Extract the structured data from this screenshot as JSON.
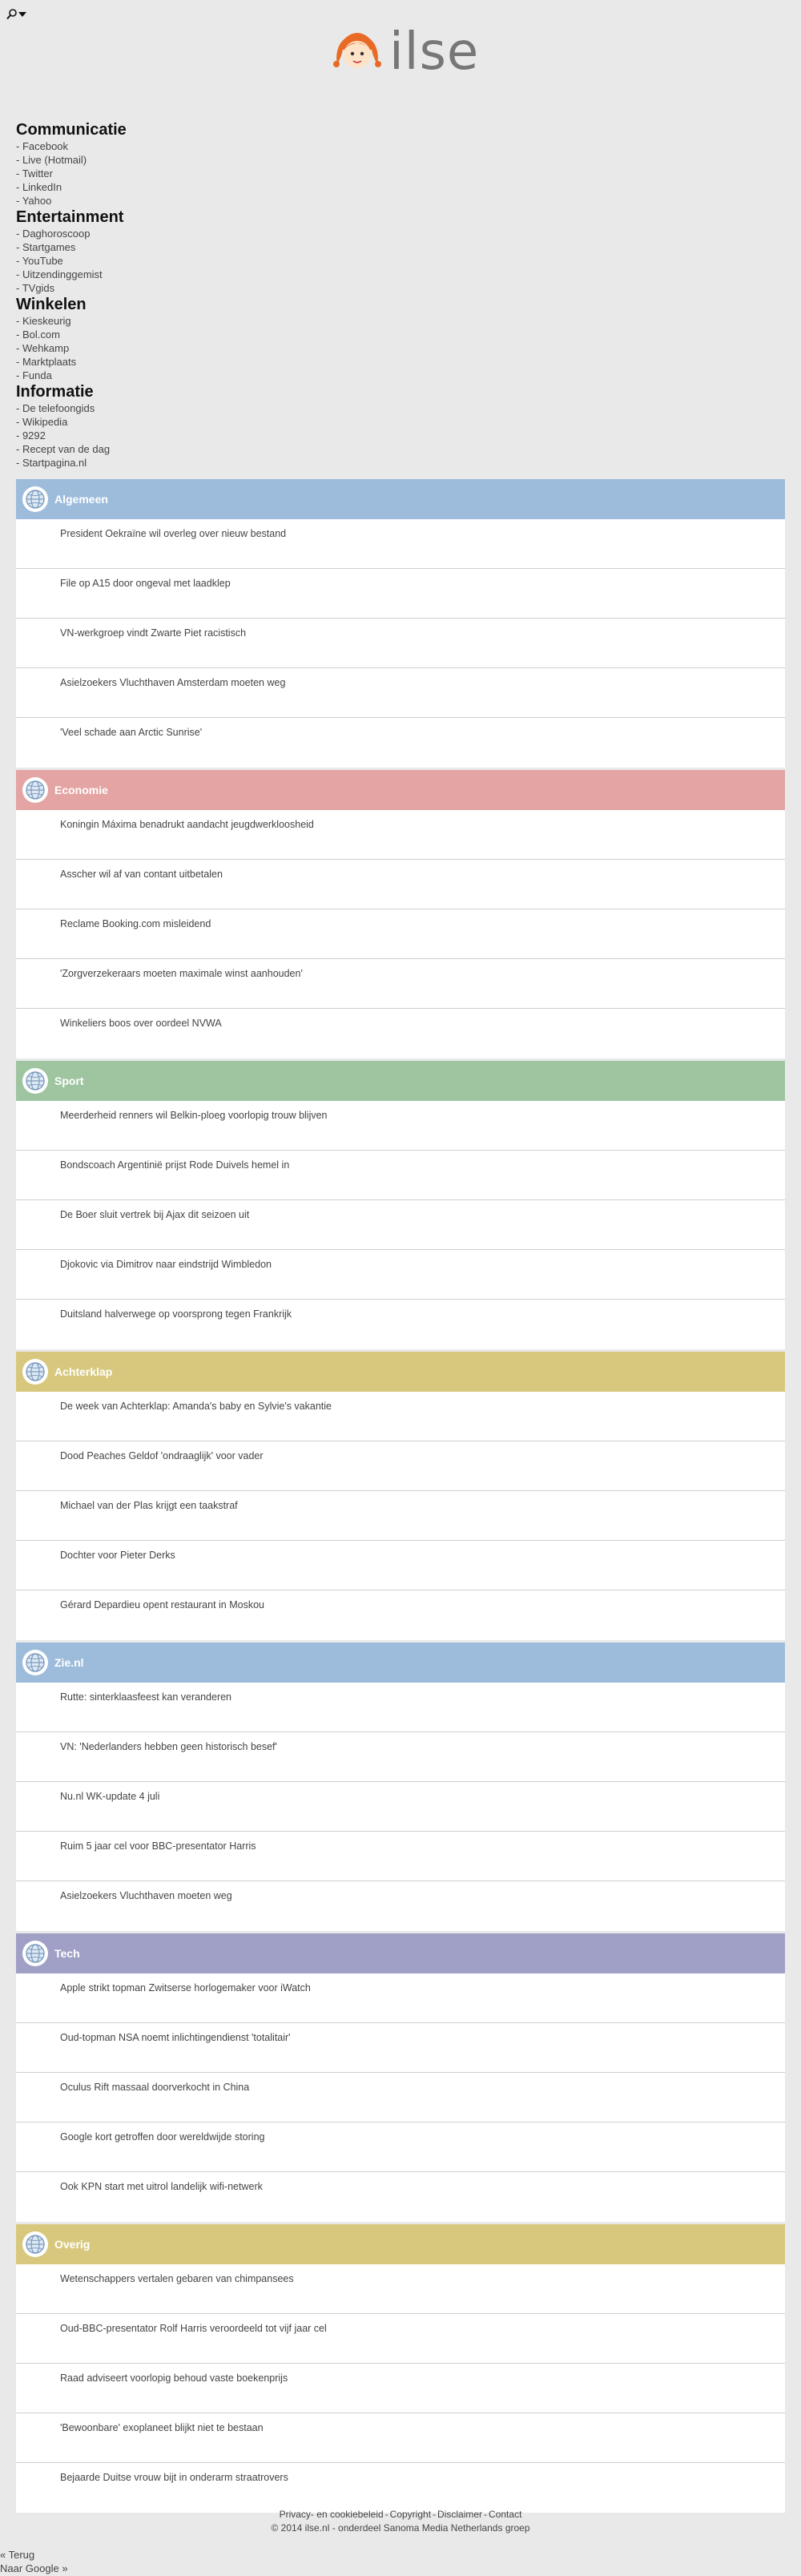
{
  "topbar": {
    "search_icon": "search-icon",
    "dropdown_icon": "caret-down-icon"
  },
  "logo": {
    "text": "ilse"
  },
  "link_groups": [
    {
      "title": "Communicatie",
      "links": [
        "- Facebook",
        "- Live (Hotmail)",
        "- Twitter",
        "- LinkedIn",
        "- Yahoo"
      ]
    },
    {
      "title": "Entertainment",
      "links": [
        "- Daghoroscoop",
        "- Startgames",
        "- YouTube",
        "- Uitzendinggemist",
        "- TVgids"
      ]
    },
    {
      "title": "Winkelen",
      "links": [
        "- Kieskeurig",
        "- Bol.com",
        "- Wehkamp",
        "- Marktplaats",
        "- Funda"
      ]
    },
    {
      "title": "Informatie",
      "links": [
        "- De telefoongids",
        "- Wikipedia",
        "- 9292",
        "- Recept van de dag",
        "- Startpagina.nl"
      ]
    }
  ],
  "sections": [
    {
      "title": "Algemeen",
      "color": "#9dbcdc",
      "items": [
        "President Oekraïne wil overleg over nieuw bestand",
        "File op A15 door ongeval met laadklep",
        "VN-werkgroep vindt Zwarte Piet racistisch",
        "Asielzoekers Vluchthaven Amsterdam moeten weg",
        "'Veel schade aan Arctic Sunrise'"
      ]
    },
    {
      "title": "Economie",
      "color": "#e4a4a3",
      "items": [
        "Koningin Máxima benadrukt aandacht jeugdwerkloosheid",
        "Asscher wil af van contant uitbetalen",
        "Reclame Booking.com misleidend",
        "'Zorgverzekeraars moeten maximale winst aanhouden'",
        "Winkeliers boos over oordeel NVWA"
      ]
    },
    {
      "title": "Sport",
      "color": "#9fc5a0",
      "items": [
        "Meerderheid renners wil Belkin-ploeg voorlopig trouw blijven",
        "Bondscoach Argentinië prijst Rode Duivels hemel in",
        "De Boer sluit vertrek bij Ajax dit seizoen uit",
        "Djokovic via Dimitrov naar eindstrijd Wimbledon",
        "Duitsland halverwege op voorsprong tegen Frankrijk"
      ]
    },
    {
      "title": "Achterklap",
      "color": "#d8c87d",
      "items": [
        "De week van Achterklap: Amanda's baby en Sylvie's vakantie",
        "Dood Peaches Geldof 'ondraaglijk' voor vader",
        "Michael van der Plas krijgt een taakstraf",
        "Dochter voor Pieter Derks",
        "Gérard Depardieu opent restaurant in Moskou"
      ]
    },
    {
      "title": "Zie.nl",
      "color": "#9dbcdc",
      "items": [
        "Rutte: sinterklaasfeest kan veranderen",
        "VN: 'Nederlanders hebben geen historisch besef'",
        "Nu.nl WK-update 4 juli",
        "Ruim 5 jaar cel voor BBC-presentator Harris",
        "Asielzoekers Vluchthaven moeten weg"
      ]
    },
    {
      "title": "Tech",
      "color": "#a09fc6",
      "items": [
        "Apple strikt topman Zwitserse horlogemaker voor iWatch",
        "Oud-topman NSA noemt inlichtingendienst 'totalitair'",
        "Oculus Rift massaal doorverkocht in China",
        "Google kort getroffen door wereldwijde storing",
        "Ook KPN start met uitrol landelijk wifi-netwerk"
      ]
    },
    {
      "title": "Overig",
      "color": "#d8c87d",
      "items": [
        "Wetenschappers vertalen gebaren van chimpansees",
        "Oud-BBC-presentator Rolf Harris veroordeeld tot vijf jaar cel",
        "Raad adviseert voorlopig behoud vaste boekenprijs",
        "'Bewoonbare' exoplaneet blijkt niet te bestaan",
        "Bejaarde Duitse vrouw bijt in onderarm straatrovers"
      ]
    }
  ],
  "footer": {
    "links": [
      "Privacy- en cookiebeleid",
      "Copyright",
      "Disclaimer",
      "Contact"
    ],
    "separator": "-",
    "copyright": "© 2014 ilse.nl - onderdeel Sanoma Media Netherlands groep"
  },
  "bottom_links": {
    "back": "« Terug",
    "google": "Naar Google »"
  }
}
